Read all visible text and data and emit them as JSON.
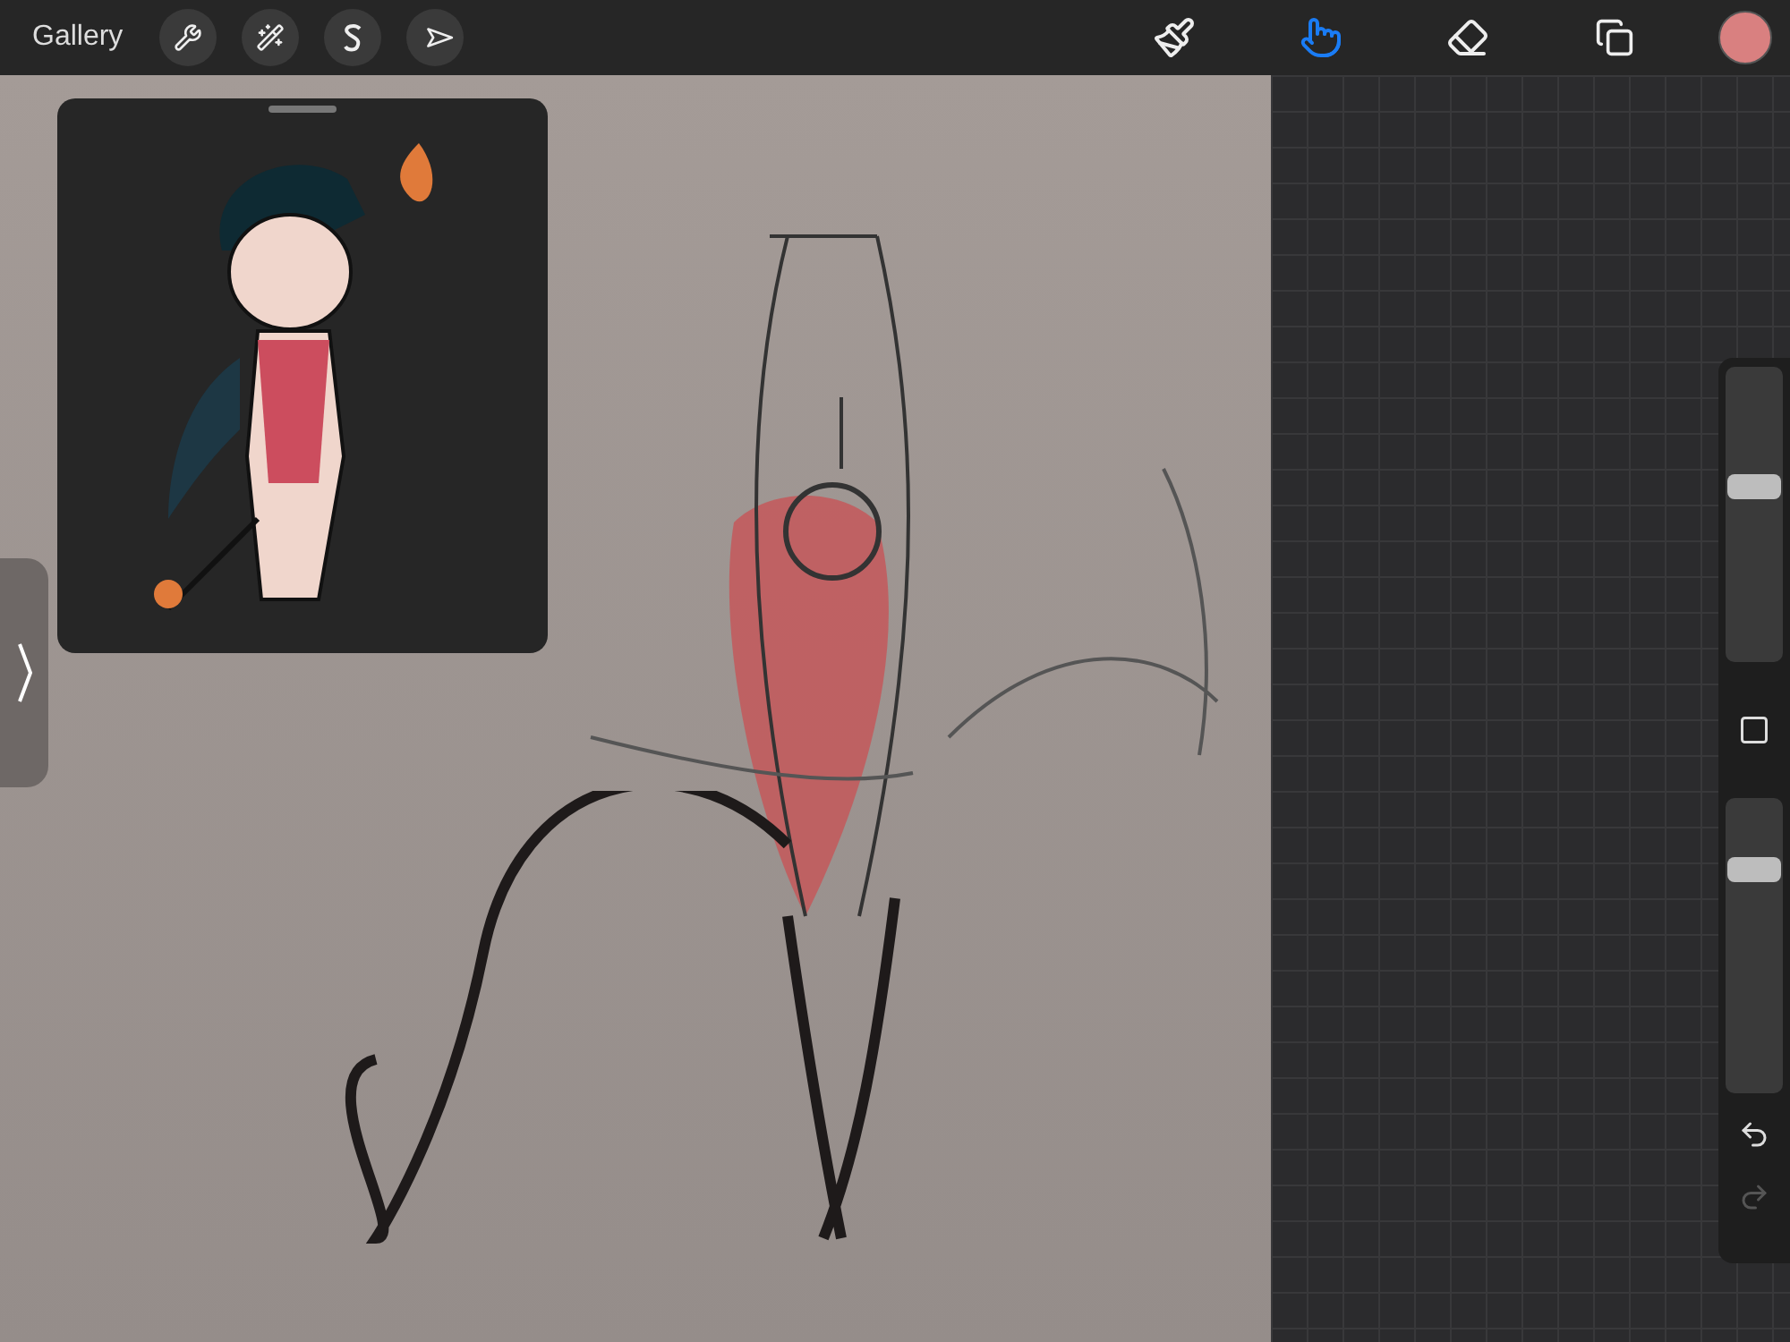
{
  "toolbar": {
    "gallery": "Gallery",
    "actions": [
      {
        "kind": "wrench"
      },
      {
        "kind": "wand"
      },
      {
        "kind": "selection"
      },
      {
        "kind": "transform"
      }
    ],
    "tools": [
      {
        "kind": "brush",
        "selected": false
      },
      {
        "kind": "smudge",
        "selected": true
      },
      {
        "kind": "eraser",
        "selected": false
      },
      {
        "kind": "layers",
        "selected": false
      }
    ],
    "color": "#d98080"
  },
  "sidebar": {
    "size": {
      "level": 0.6
    },
    "opacity": {
      "level": 0.78
    },
    "undo": {
      "disabled": false
    },
    "redo": {
      "disabled": true
    }
  }
}
